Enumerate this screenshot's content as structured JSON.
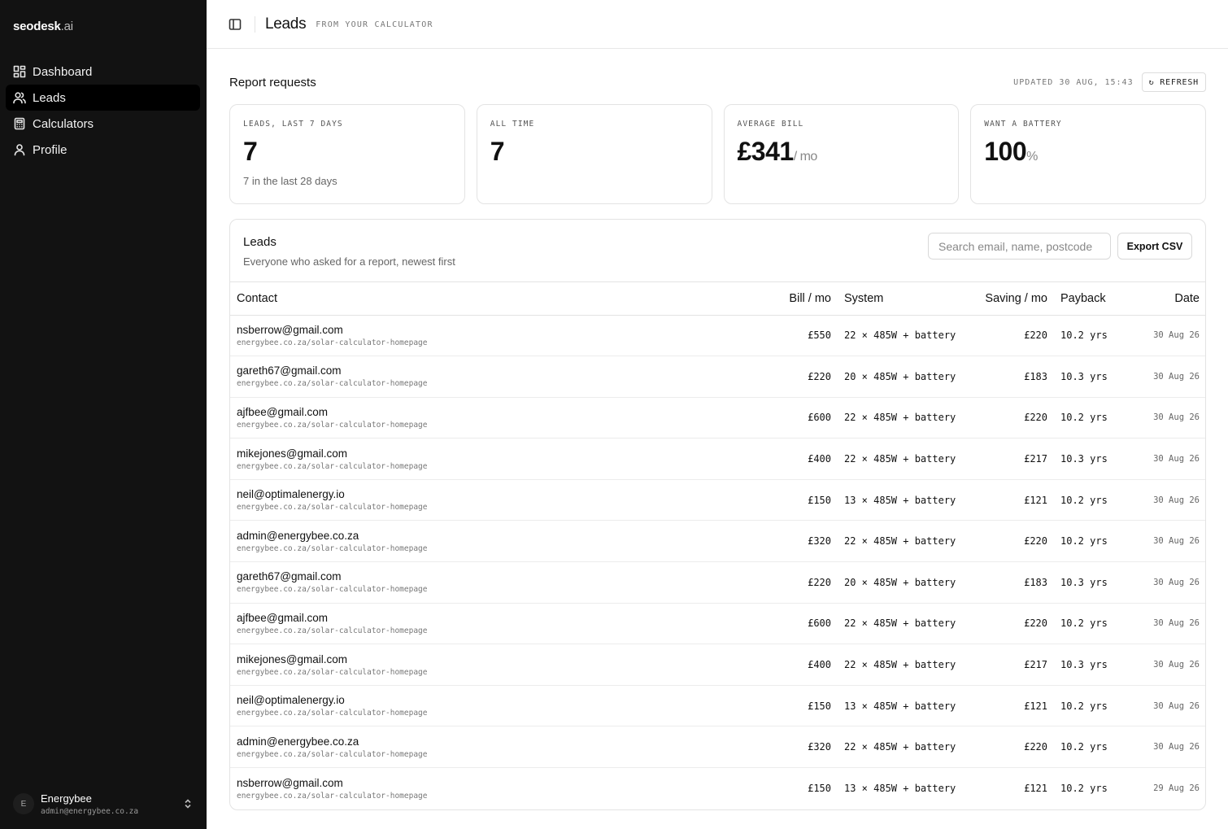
{
  "brand": {
    "name": "seodesk",
    "tld": ".ai"
  },
  "nav": [
    {
      "label": "Dashboard",
      "icon": "grid-icon"
    },
    {
      "label": "Leads",
      "icon": "users-icon",
      "active": true
    },
    {
      "label": "Calculators",
      "icon": "calculator-icon"
    },
    {
      "label": "Profile",
      "icon": "user-icon"
    }
  ],
  "account": {
    "initial": "E",
    "name": "Energybee",
    "email": "admin@energybee.co.za"
  },
  "header": {
    "title": "Leads",
    "subtitle": "FROM YOUR CALCULATOR"
  },
  "report": {
    "title": "Report requests",
    "updated": "UPDATED 30 AUG, 15:43",
    "refresh_label": "↻ REFRESH"
  },
  "stats": [
    {
      "label": "LEADS, LAST 7 DAYS",
      "value": "7",
      "unit": "",
      "note": "7 in the last 28 days"
    },
    {
      "label": "ALL TIME",
      "value": "7",
      "unit": "",
      "note": ""
    },
    {
      "label": "AVERAGE BILL",
      "value": "£341",
      "unit": "/ mo",
      "note": ""
    },
    {
      "label": "WANT A BATTERY",
      "value": "100",
      "unit": "%",
      "note": ""
    }
  ],
  "leads": {
    "title": "Leads",
    "description": "Everyone who asked for a report, newest first",
    "search_placeholder": "Search email, name, postcode",
    "export_label": "Export CSV",
    "columns": [
      "Contact",
      "Bill / mo",
      "System",
      "Saving / mo",
      "Payback",
      "Date"
    ],
    "rows": [
      {
        "email": "nsberrow@gmail.com",
        "source": "energybee.co.za/solar-calculator-homepage",
        "bill": "£550",
        "system": "22 × 485W + battery",
        "saving": "£220",
        "payback": "10.2 yrs",
        "date": "30 Aug 26"
      },
      {
        "email": "gareth67@gmail.com",
        "source": "energybee.co.za/solar-calculator-homepage",
        "bill": "£220",
        "system": "20 × 485W + battery",
        "saving": "£183",
        "payback": "10.3 yrs",
        "date": "30 Aug 26"
      },
      {
        "email": "ajfbee@gmail.com",
        "source": "energybee.co.za/solar-calculator-homepage",
        "bill": "£600",
        "system": "22 × 485W + battery",
        "saving": "£220",
        "payback": "10.2 yrs",
        "date": "30 Aug 26"
      },
      {
        "email": "mikejones@gmail.com",
        "source": "energybee.co.za/solar-calculator-homepage",
        "bill": "£400",
        "system": "22 × 485W + battery",
        "saving": "£217",
        "payback": "10.3 yrs",
        "date": "30 Aug 26"
      },
      {
        "email": "neil@optimalenergy.io",
        "source": "energybee.co.za/solar-calculator-homepage",
        "bill": "£150",
        "system": "13 × 485W + battery",
        "saving": "£121",
        "payback": "10.2 yrs",
        "date": "30 Aug 26"
      },
      {
        "email": "admin@energybee.co.za",
        "source": "energybee.co.za/solar-calculator-homepage",
        "bill": "£320",
        "system": "22 × 485W + battery",
        "saving": "£220",
        "payback": "10.2 yrs",
        "date": "30 Aug 26"
      },
      {
        "email": "gareth67@gmail.com",
        "source": "energybee.co.za/solar-calculator-homepage",
        "bill": "£220",
        "system": "20 × 485W + battery",
        "saving": "£183",
        "payback": "10.3 yrs",
        "date": "30 Aug 26"
      },
      {
        "email": "ajfbee@gmail.com",
        "source": "energybee.co.za/solar-calculator-homepage",
        "bill": "£600",
        "system": "22 × 485W + battery",
        "saving": "£220",
        "payback": "10.2 yrs",
        "date": "30 Aug 26"
      },
      {
        "email": "mikejones@gmail.com",
        "source": "energybee.co.za/solar-calculator-homepage",
        "bill": "£400",
        "system": "22 × 485W + battery",
        "saving": "£217",
        "payback": "10.3 yrs",
        "date": "30 Aug 26"
      },
      {
        "email": "neil@optimalenergy.io",
        "source": "energybee.co.za/solar-calculator-homepage",
        "bill": "£150",
        "system": "13 × 485W + battery",
        "saving": "£121",
        "payback": "10.2 yrs",
        "date": "30 Aug 26"
      },
      {
        "email": "admin@energybee.co.za",
        "source": "energybee.co.za/solar-calculator-homepage",
        "bill": "£320",
        "system": "22 × 485W + battery",
        "saving": "£220",
        "payback": "10.2 yrs",
        "date": "30 Aug 26"
      },
      {
        "email": "nsberrow@gmail.com",
        "source": "energybee.co.za/solar-calculator-homepage",
        "bill": "£150",
        "system": "13 × 485W + battery",
        "saving": "£121",
        "payback": "10.2 yrs",
        "date": "29 Aug 26"
      }
    ]
  }
}
